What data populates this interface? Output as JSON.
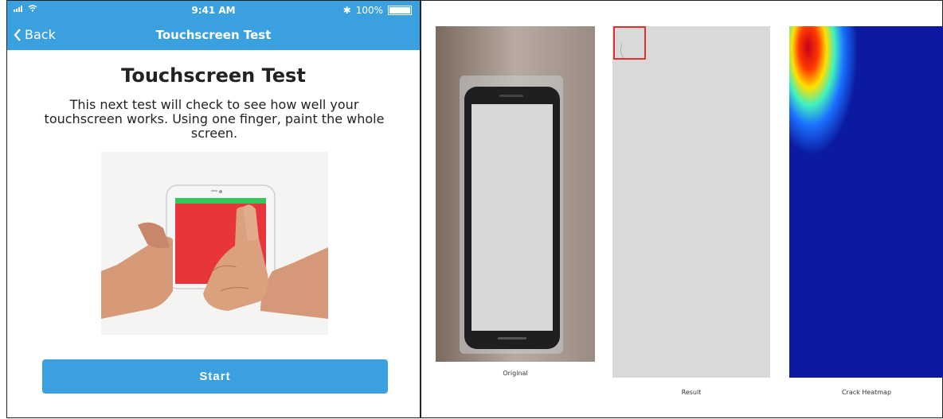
{
  "status": {
    "time": "9:41 AM",
    "battery": "100%"
  },
  "nav": {
    "back_label": "Back",
    "title": "Touchscreen Test"
  },
  "main": {
    "title": "Touchscreen Test",
    "instructions": "This next test will check to see how well your touchscreen works. Using one finger, paint the whole screen.",
    "start_label": "Start"
  },
  "panels": {
    "original_label": "Original",
    "result_label": "Result",
    "heatmap_label": "Crack Heatmap"
  },
  "colors": {
    "accent": "#3aa0e0",
    "phone_red": "#e8343b",
    "phone_green": "#34c759",
    "heatmap_bg": "#0b1aa0"
  }
}
